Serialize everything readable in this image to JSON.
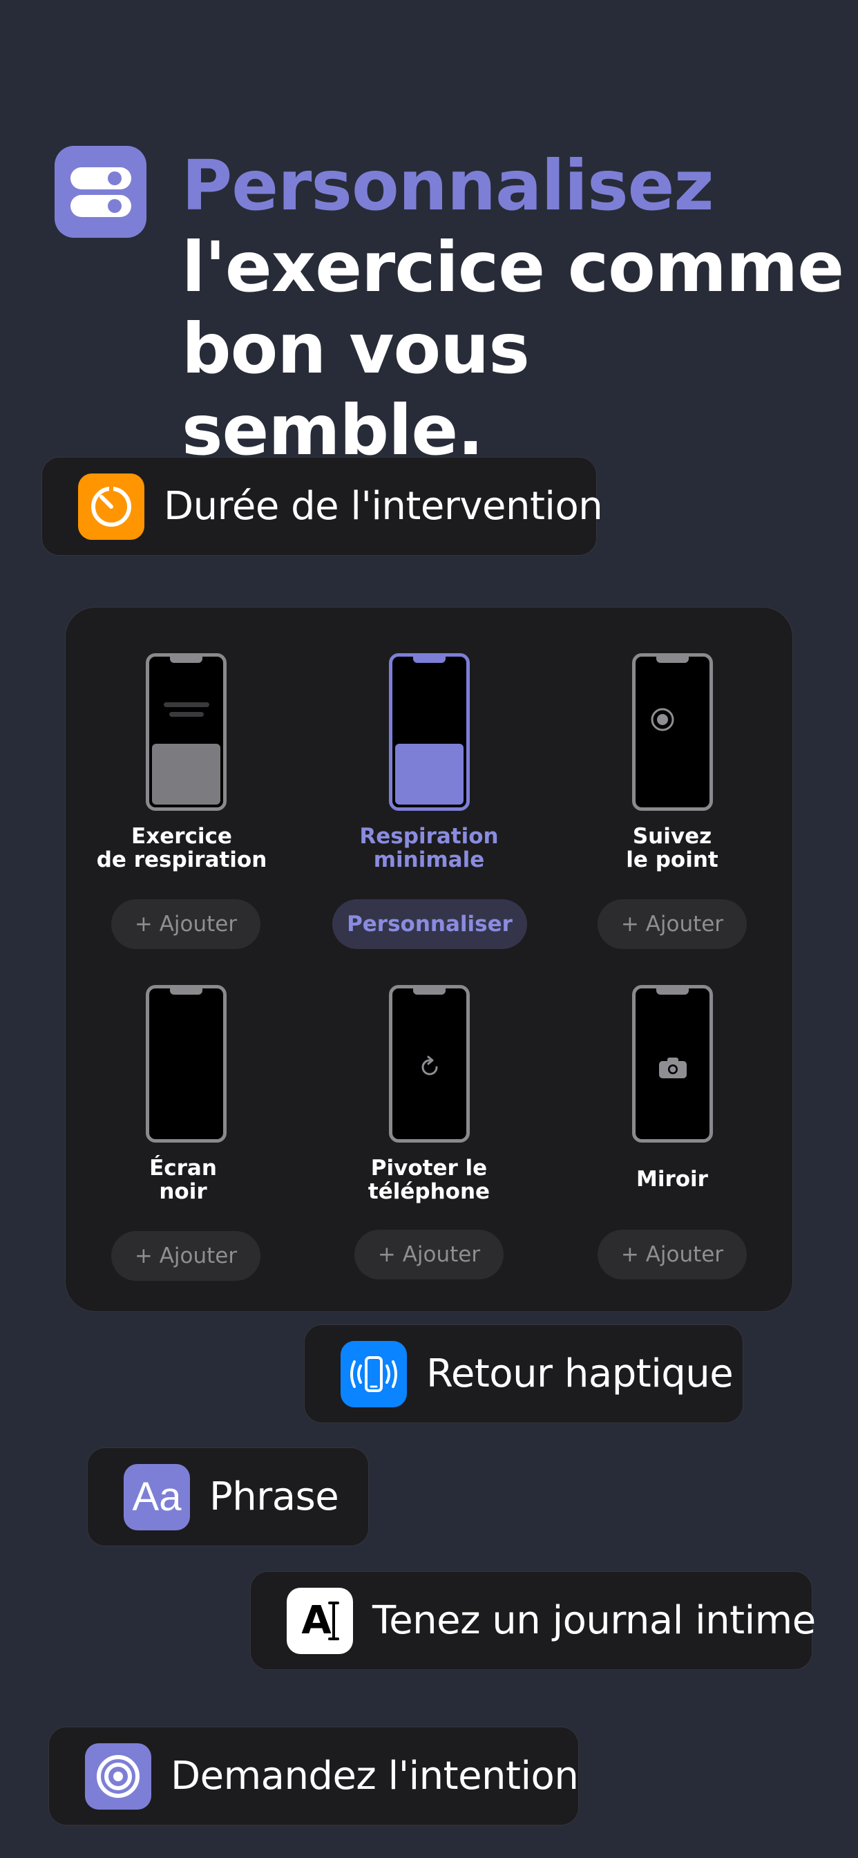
{
  "header": {
    "title_accent": "Personnalisez",
    "title_line2": "l'exercice comme",
    "title_line3": "bon vous semble.",
    "icon": "toggles-icon",
    "icon_color": "#7d7fd6"
  },
  "features": {
    "duration": {
      "label": "Durée de l'intervention",
      "icon": "timer-icon",
      "color": "#ff9500"
    },
    "haptic": {
      "label": "Retour haptique",
      "icon": "phone-vibrate-icon",
      "color": "#0a84ff"
    },
    "phrase": {
      "label": "Phrase",
      "icon_text": "Aa",
      "icon": "text-format-icon",
      "color": "#7d7fd6"
    },
    "journal": {
      "label": "Tenez un journal intime",
      "icon_text": "A",
      "icon": "text-cursor-icon",
      "color": "#ffffff"
    },
    "intention": {
      "label": "Demandez l'intention",
      "icon": "target-icon",
      "color": "#7d7fd6"
    }
  },
  "exercises": [
    {
      "title_l1": "Exercice",
      "title_l2": "de respiration",
      "action": "+ Ajouter",
      "active": false
    },
    {
      "title_l1": "Respiration",
      "title_l2": "minimale",
      "action": "Personnaliser",
      "active": true
    },
    {
      "title_l1": "Suivez",
      "title_l2": "le point",
      "action": "+ Ajouter",
      "active": false
    },
    {
      "title_l1": "Écran",
      "title_l2": "noir",
      "action": "+ Ajouter",
      "active": false
    },
    {
      "title_l1": "Pivoter le",
      "title_l2": "téléphone",
      "action": "+ Ajouter",
      "active": false
    },
    {
      "title_l1": "Miroir",
      "title_l2": "",
      "action": "+ Ajouter",
      "active": false
    }
  ]
}
